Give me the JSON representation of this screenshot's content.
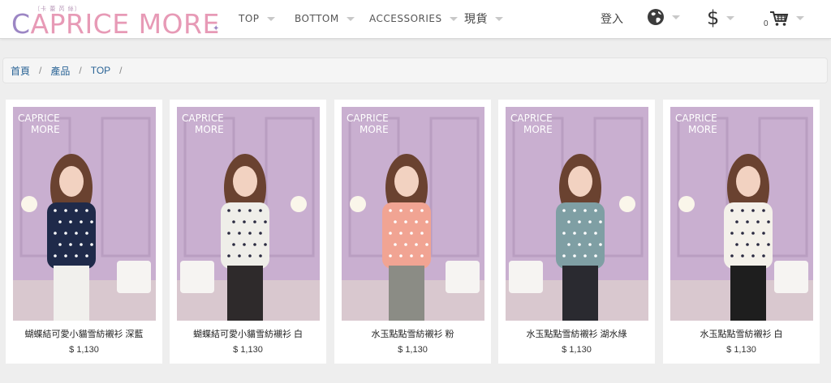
{
  "brand": {
    "tagline": "〔卡 蕾 芮 絲〕",
    "logo_part1": "C",
    "logo_part2": "APRICE MORE",
    "photo_watermark_line1": "CAPRICE",
    "photo_watermark_line2": "MORE"
  },
  "nav": {
    "items": [
      {
        "label": "TOP"
      },
      {
        "label": "BOTTOM"
      },
      {
        "label": "ACCESSORIES"
      },
      {
        "label": "現貨"
      }
    ],
    "login_label": "登入",
    "currency_symbol": "$",
    "cart_count": "0",
    "icons": [
      "globe-icon",
      "dollar-icon",
      "cart-icon"
    ]
  },
  "breadcrumb": {
    "items": [
      "首頁",
      "產品",
      "TOP"
    ],
    "separator": "/"
  },
  "products": [
    {
      "name": "蝴蝶結可愛小貓雪紡襯衫 深藍",
      "price": "$ 1,130",
      "top_color": "#1f2a4a",
      "bottom_color": "#f1f0ed"
    },
    {
      "name": "蝴蝶結可愛小貓雪紡襯衫 白",
      "price": "$ 1,130",
      "top_color": "#efeee9",
      "bottom_color": "#2e2a2b"
    },
    {
      "name": "水玉點點雪紡襯衫 粉",
      "price": "$ 1,130",
      "top_color": "#f1a493",
      "bottom_color": "#8b8c85"
    },
    {
      "name": "水玉點點雪紡襯衫 湖水綠",
      "price": "$ 1,130",
      "top_color": "#7f9fa4",
      "bottom_color": "#2a2a30"
    },
    {
      "name": "水玉點點雪紡襯衫 白",
      "price": "$ 1,130",
      "top_color": "#f4f1ea",
      "bottom_color": "#1e1e1e"
    }
  ],
  "colors": {
    "logo_purple": "#9c86c4",
    "logo_pink": "#e79ab6",
    "link_blue": "#2a6496",
    "wall_purple": "#c9afd0"
  }
}
